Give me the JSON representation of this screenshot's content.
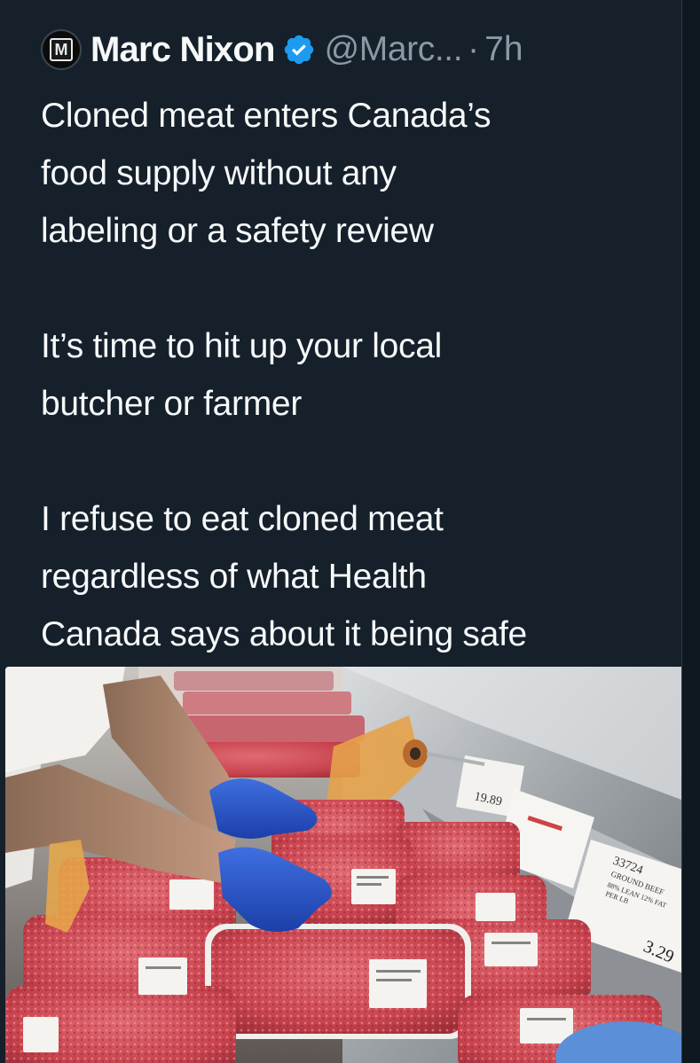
{
  "tweet": {
    "author": {
      "avatar_letter": "M",
      "display_name": "Marc Nixon",
      "handle": "@Marc...",
      "separator": "·",
      "time": "7h",
      "verified_icon": "verified-badge-icon"
    },
    "paragraphs": [
      [
        "Cloned meat enters Canada’s",
        "food supply without any",
        "labeling or a safety review"
      ],
      [
        "It’s time to hit up your local",
        "butcher or farmer"
      ],
      [
        "I refuse to eat cloned meat",
        "regardless of what Health",
        "Canada says about it being safe"
      ]
    ],
    "photo": {
      "price_labels": [
        "19.89",
        "3.29"
      ],
      "sign_text": [
        "33724",
        "GROUND BEEF",
        "88% LEAN 12% FAT",
        "PER LB"
      ]
    }
  },
  "colors": {
    "background": "#15202b",
    "text": "#f7f9f9",
    "muted": "#8b98a5",
    "verified": "#1d9bf0"
  }
}
